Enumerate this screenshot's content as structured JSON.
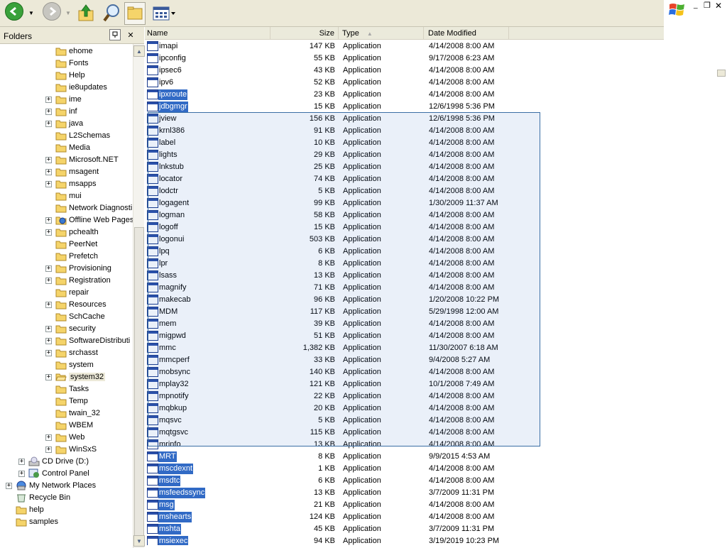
{
  "colors": {
    "selection": "#316ac5",
    "marquee": "#3a6ea5",
    "toolbar_bg": "#ece9d8",
    "folder_yellow": "#f5d46a"
  },
  "toolbar": {
    "back_icon": "back-arrow-icon",
    "forward_icon": "forward-arrow-icon",
    "up_icon": "up-folder-icon",
    "search_icon": "search-icon",
    "folders_icon": "folders-icon",
    "views_icon": "views-icon"
  },
  "folders_pane": {
    "title": "Folders",
    "close_label": "✕",
    "items": [
      {
        "label": "ehome",
        "level": 4,
        "expandable": false,
        "icon": "folder"
      },
      {
        "label": "Fonts",
        "level": 4,
        "expandable": false,
        "icon": "folder"
      },
      {
        "label": "Help",
        "level": 4,
        "expandable": false,
        "icon": "folder"
      },
      {
        "label": "ie8updates",
        "level": 4,
        "expandable": false,
        "icon": "folder"
      },
      {
        "label": "ime",
        "level": 4,
        "expandable": true,
        "icon": "folder"
      },
      {
        "label": "inf",
        "level": 4,
        "expandable": true,
        "icon": "folder"
      },
      {
        "label": "java",
        "level": 4,
        "expandable": true,
        "icon": "folder"
      },
      {
        "label": "L2Schemas",
        "level": 4,
        "expandable": false,
        "icon": "folder"
      },
      {
        "label": "Media",
        "level": 4,
        "expandable": false,
        "icon": "folder"
      },
      {
        "label": "Microsoft.NET",
        "level": 4,
        "expandable": true,
        "icon": "folder"
      },
      {
        "label": "msagent",
        "level": 4,
        "expandable": true,
        "icon": "folder"
      },
      {
        "label": "msapps",
        "level": 4,
        "expandable": true,
        "icon": "folder"
      },
      {
        "label": "mui",
        "level": 4,
        "expandable": false,
        "icon": "folder"
      },
      {
        "label": "Network Diagnosti",
        "level": 4,
        "expandable": false,
        "icon": "folder"
      },
      {
        "label": "Offline Web Pages",
        "level": 4,
        "expandable": true,
        "icon": "offline"
      },
      {
        "label": "pchealth",
        "level": 4,
        "expandable": true,
        "icon": "folder"
      },
      {
        "label": "PeerNet",
        "level": 4,
        "expandable": false,
        "icon": "folder"
      },
      {
        "label": "Prefetch",
        "level": 4,
        "expandable": false,
        "icon": "folder"
      },
      {
        "label": "Provisioning",
        "level": 4,
        "expandable": true,
        "icon": "folder"
      },
      {
        "label": "Registration",
        "level": 4,
        "expandable": true,
        "icon": "folder"
      },
      {
        "label": "repair",
        "level": 4,
        "expandable": false,
        "icon": "folder"
      },
      {
        "label": "Resources",
        "level": 4,
        "expandable": true,
        "icon": "folder"
      },
      {
        "label": "SchCache",
        "level": 4,
        "expandable": false,
        "icon": "folder"
      },
      {
        "label": "security",
        "level": 4,
        "expandable": true,
        "icon": "folder"
      },
      {
        "label": "SoftwareDistributi",
        "level": 4,
        "expandable": true,
        "icon": "folder"
      },
      {
        "label": "srchasst",
        "level": 4,
        "expandable": true,
        "icon": "folder"
      },
      {
        "label": "system",
        "level": 4,
        "expandable": false,
        "icon": "folder"
      },
      {
        "label": "system32",
        "level": 4,
        "expandable": true,
        "icon": "folder-open",
        "selected": true
      },
      {
        "label": "Tasks",
        "level": 4,
        "expandable": false,
        "icon": "folder"
      },
      {
        "label": "Temp",
        "level": 4,
        "expandable": false,
        "icon": "folder"
      },
      {
        "label": "twain_32",
        "level": 4,
        "expandable": false,
        "icon": "folder"
      },
      {
        "label": "WBEM",
        "level": 4,
        "expandable": false,
        "icon": "folder"
      },
      {
        "label": "Web",
        "level": 4,
        "expandable": true,
        "icon": "folder"
      },
      {
        "label": "WinSxS",
        "level": 4,
        "expandable": true,
        "icon": "folder"
      },
      {
        "label": "CD Drive (D:)",
        "level": 2,
        "expandable": true,
        "icon": "cd-drive"
      },
      {
        "label": "Control Panel",
        "level": 2,
        "expandable": true,
        "icon": "control-panel"
      },
      {
        "label": "My Network Places",
        "level": 1,
        "expandable": true,
        "icon": "network"
      },
      {
        "label": "Recycle Bin",
        "level": 1,
        "expandable": false,
        "icon": "recycle-bin"
      },
      {
        "label": "help",
        "level": 1,
        "expandable": false,
        "icon": "folder"
      },
      {
        "label": "samples",
        "level": 1,
        "expandable": false,
        "icon": "folder"
      }
    ]
  },
  "file_list": {
    "columns": {
      "name": "Name",
      "size": "Size",
      "type": "Type",
      "date": "Date Modified"
    },
    "rows": [
      {
        "name": "imapi",
        "size": "147 KB",
        "type": "Application",
        "date": "4/14/2008 8:00 AM",
        "selected": false
      },
      {
        "name": "ipconfig",
        "size": "55 KB",
        "type": "Application",
        "date": "9/17/2008 6:23 AM",
        "selected": false
      },
      {
        "name": "ipsec6",
        "size": "43 KB",
        "type": "Application",
        "date": "4/14/2008 8:00 AM",
        "selected": false
      },
      {
        "name": "ipv6",
        "size": "52 KB",
        "type": "Application",
        "date": "4/14/2008 8:00 AM",
        "selected": false
      },
      {
        "name": "ipxroute",
        "size": "23 KB",
        "type": "Application",
        "date": "4/14/2008 8:00 AM",
        "selected": true
      },
      {
        "name": "jdbgmgr",
        "size": "15 KB",
        "type": "Application",
        "date": "12/6/1998 5:36 PM",
        "selected": true
      },
      {
        "name": "jview",
        "size": "156 KB",
        "type": "Application",
        "date": "12/6/1998 5:36 PM",
        "selected": false
      },
      {
        "name": "krnl386",
        "size": "91 KB",
        "type": "Application",
        "date": "4/14/2008 8:00 AM",
        "selected": false
      },
      {
        "name": "label",
        "size": "10 KB",
        "type": "Application",
        "date": "4/14/2008 8:00 AM",
        "selected": false
      },
      {
        "name": "lights",
        "size": "29 KB",
        "type": "Application",
        "date": "4/14/2008 8:00 AM",
        "selected": false
      },
      {
        "name": "lnkstub",
        "size": "25 KB",
        "type": "Application",
        "date": "4/14/2008 8:00 AM",
        "selected": false
      },
      {
        "name": "locator",
        "size": "74 KB",
        "type": "Application",
        "date": "4/14/2008 8:00 AM",
        "selected": false
      },
      {
        "name": "lodctr",
        "size": "5 KB",
        "type": "Application",
        "date": "4/14/2008 8:00 AM",
        "selected": false
      },
      {
        "name": "logagent",
        "size": "99 KB",
        "type": "Application",
        "date": "1/30/2009 11:37 AM",
        "selected": false
      },
      {
        "name": "logman",
        "size": "58 KB",
        "type": "Application",
        "date": "4/14/2008 8:00 AM",
        "selected": false
      },
      {
        "name": "logoff",
        "size": "15 KB",
        "type": "Application",
        "date": "4/14/2008 8:00 AM",
        "selected": false
      },
      {
        "name": "logonui",
        "size": "503 KB",
        "type": "Application",
        "date": "4/14/2008 8:00 AM",
        "selected": false
      },
      {
        "name": "lpq",
        "size": "6 KB",
        "type": "Application",
        "date": "4/14/2008 8:00 AM",
        "selected": false
      },
      {
        "name": "lpr",
        "size": "8 KB",
        "type": "Application",
        "date": "4/14/2008 8:00 AM",
        "selected": false
      },
      {
        "name": "lsass",
        "size": "13 KB",
        "type": "Application",
        "date": "4/14/2008 8:00 AM",
        "selected": false
      },
      {
        "name": "magnify",
        "size": "71 KB",
        "type": "Application",
        "date": "4/14/2008 8:00 AM",
        "selected": false
      },
      {
        "name": "makecab",
        "size": "96 KB",
        "type": "Application",
        "date": "1/20/2008 10:22 PM",
        "selected": false
      },
      {
        "name": "MDM",
        "size": "117 KB",
        "type": "Application",
        "date": "5/29/1998 12:00 AM",
        "selected": false
      },
      {
        "name": "mem",
        "size": "39 KB",
        "type": "Application",
        "date": "4/14/2008 8:00 AM",
        "selected": false
      },
      {
        "name": "migpwd",
        "size": "51 KB",
        "type": "Application",
        "date": "4/14/2008 8:00 AM",
        "selected": false
      },
      {
        "name": "mmc",
        "size": "1,382 KB",
        "type": "Application",
        "date": "11/30/2007 6:18 AM",
        "selected": false
      },
      {
        "name": "mmcperf",
        "size": "33 KB",
        "type": "Application",
        "date": "9/4/2008 5:27 AM",
        "selected": false
      },
      {
        "name": "mobsync",
        "size": "140 KB",
        "type": "Application",
        "date": "4/14/2008 8:00 AM",
        "selected": false
      },
      {
        "name": "mplay32",
        "size": "121 KB",
        "type": "Application",
        "date": "10/1/2008 7:49 AM",
        "selected": false
      },
      {
        "name": "mpnotify",
        "size": "22 KB",
        "type": "Application",
        "date": "4/14/2008 8:00 AM",
        "selected": false
      },
      {
        "name": "mqbkup",
        "size": "20 KB",
        "type": "Application",
        "date": "4/14/2008 8:00 AM",
        "selected": false
      },
      {
        "name": "mqsvc",
        "size": "5 KB",
        "type": "Application",
        "date": "4/14/2008 8:00 AM",
        "selected": false
      },
      {
        "name": "mqtgsvc",
        "size": "115 KB",
        "type": "Application",
        "date": "4/14/2008 8:00 AM",
        "selected": false
      },
      {
        "name": "mrinfo",
        "size": "13 KB",
        "type": "Application",
        "date": "4/14/2008 8:00 AM",
        "selected": false
      },
      {
        "name": "MRT",
        "size": "8 KB",
        "type": "Application",
        "date": "9/9/2015 4:53 AM",
        "selected": true
      },
      {
        "name": "mscdexnt",
        "size": "1 KB",
        "type": "Application",
        "date": "4/14/2008 8:00 AM",
        "selected": true
      },
      {
        "name": "msdtc",
        "size": "6 KB",
        "type": "Application",
        "date": "4/14/2008 8:00 AM",
        "selected": true
      },
      {
        "name": "msfeedssync",
        "size": "13 KB",
        "type": "Application",
        "date": "3/7/2009 11:31 PM",
        "selected": true
      },
      {
        "name": "msg",
        "size": "21 KB",
        "type": "Application",
        "date": "4/14/2008 8:00 AM",
        "selected": true
      },
      {
        "name": "mshearts",
        "size": "124 KB",
        "type": "Application",
        "date": "4/14/2008 8:00 AM",
        "selected": true
      },
      {
        "name": "mshta",
        "size": "45 KB",
        "type": "Application",
        "date": "3/7/2009 11:31 PM",
        "selected": true
      },
      {
        "name": "msiexec",
        "size": "94 KB",
        "type": "Application",
        "date": "3/19/2019 10:23 PM",
        "selected": true
      }
    ]
  }
}
